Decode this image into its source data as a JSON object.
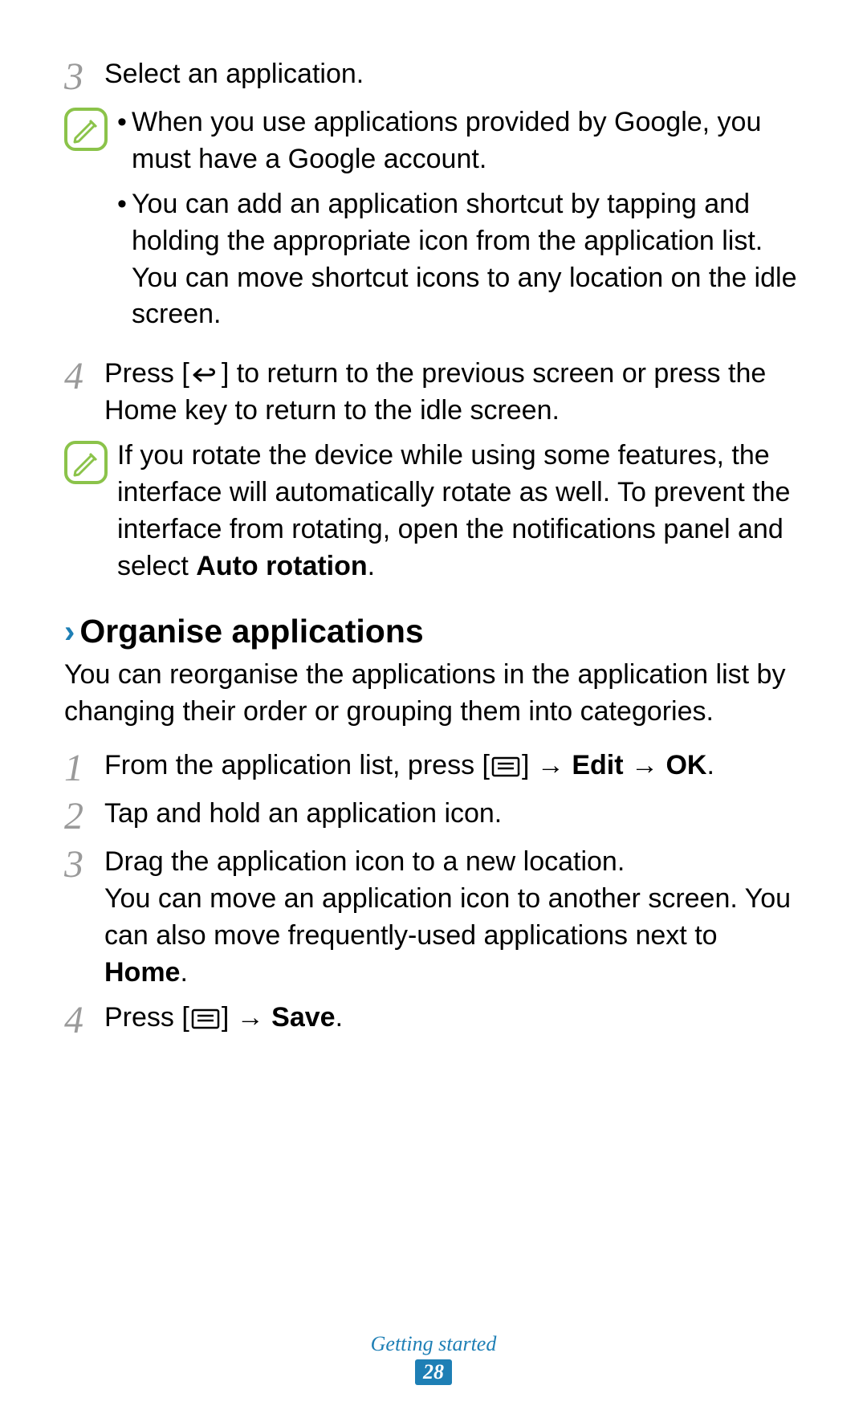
{
  "step3": {
    "num": "3",
    "text": "Select an application."
  },
  "note1": {
    "bullets": [
      "When you use applications provided by Google, you must have a Google account.",
      "You can add an application shortcut by tapping and holding the appropriate icon from the application list. You can move shortcut icons to any location on the idle screen."
    ]
  },
  "step4a": {
    "num": "4",
    "pre": "Press [",
    "post": "] to return to the previous screen or press the Home key to return to the idle screen."
  },
  "note2": {
    "pre": "If you rotate the device while using some features, the interface will automatically rotate as well. To prevent the interface from rotating, open the notifications panel and select ",
    "bold": "Auto rotation",
    "post": "."
  },
  "section": {
    "title": "Organise applications",
    "intro": "You can reorganise the applications in the application list by changing their order or grouping them into categories."
  },
  "s1": {
    "num": "1",
    "pre": "From the application list, press [",
    "mid": "] → ",
    "b1": "Edit",
    "mid2": " → ",
    "b2": "OK",
    "post": "."
  },
  "s2": {
    "num": "2",
    "text": "Tap and hold an application icon."
  },
  "s3": {
    "num": "3",
    "line1": "Drag the application icon to a new location.",
    "line2a": "You can move an application icon to another screen. You can also move frequently-used applications next to ",
    "line2b": "Home",
    "line2c": "."
  },
  "s4": {
    "num": "4",
    "pre": "Press [",
    "mid": "] → ",
    "b1": "Save",
    "post": "."
  },
  "footer": {
    "category": "Getting started",
    "page": "28"
  }
}
